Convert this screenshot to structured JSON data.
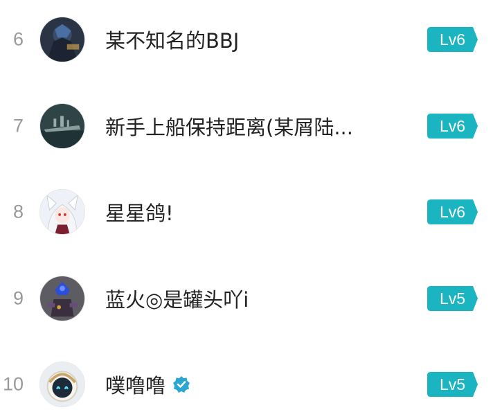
{
  "ranking": {
    "items": [
      {
        "rank": "6",
        "name": "某不知名的BBJ",
        "level": "Lv6",
        "verified": false
      },
      {
        "rank": "7",
        "name": "新手上船保持距离(某屑陆...",
        "level": "Lv6",
        "verified": false
      },
      {
        "rank": "8",
        "name": "星星鸽!",
        "level": "Lv6",
        "verified": false
      },
      {
        "rank": "9",
        "name": "蓝火◎是罐头吖i",
        "level": "Lv5",
        "verified": false
      },
      {
        "rank": "10",
        "name": "噗噜噜",
        "level": "Lv5",
        "verified": true
      }
    ]
  },
  "colors": {
    "badge_fill": "#1bb5c2",
    "rank_text": "#999999",
    "name_text": "#222222",
    "verified": "#2aa7d0"
  },
  "icons": {
    "verified": "verified-check-icon"
  }
}
